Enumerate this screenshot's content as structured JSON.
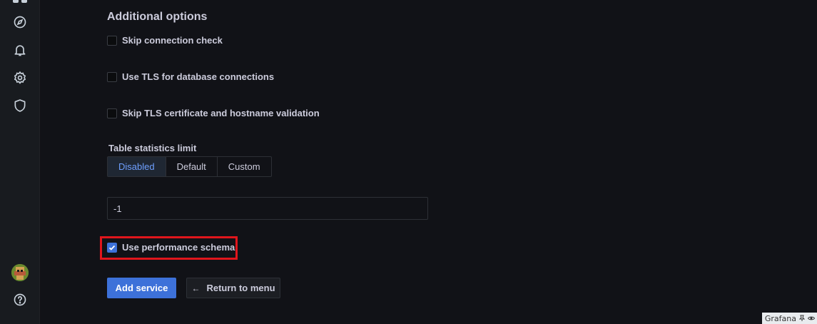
{
  "sidebar": {
    "icons": [
      "explore-icon",
      "alerting-bell-icon",
      "settings-gear-icon",
      "shield-icon",
      "help-icon"
    ]
  },
  "form": {
    "section_title": "Additional options",
    "checkboxes": [
      {
        "label": "Skip connection check",
        "checked": false
      },
      {
        "label": "Use TLS for database connections",
        "checked": false
      },
      {
        "label": "Skip TLS certificate and hostname validation",
        "checked": false
      }
    ],
    "table_stats": {
      "label": "Table statistics limit",
      "options": [
        "Disabled",
        "Default",
        "Custom"
      ],
      "selected": "Disabled",
      "value": "-1"
    },
    "performance_schema": {
      "label": "Use performance schema",
      "checked": true
    },
    "add_button": "Add service",
    "return_button": "Return to menu"
  },
  "footer": {
    "label": "Grafana"
  },
  "colors": {
    "accent": "#3d71d9",
    "highlight": "#e0161c",
    "background": "#111217"
  }
}
